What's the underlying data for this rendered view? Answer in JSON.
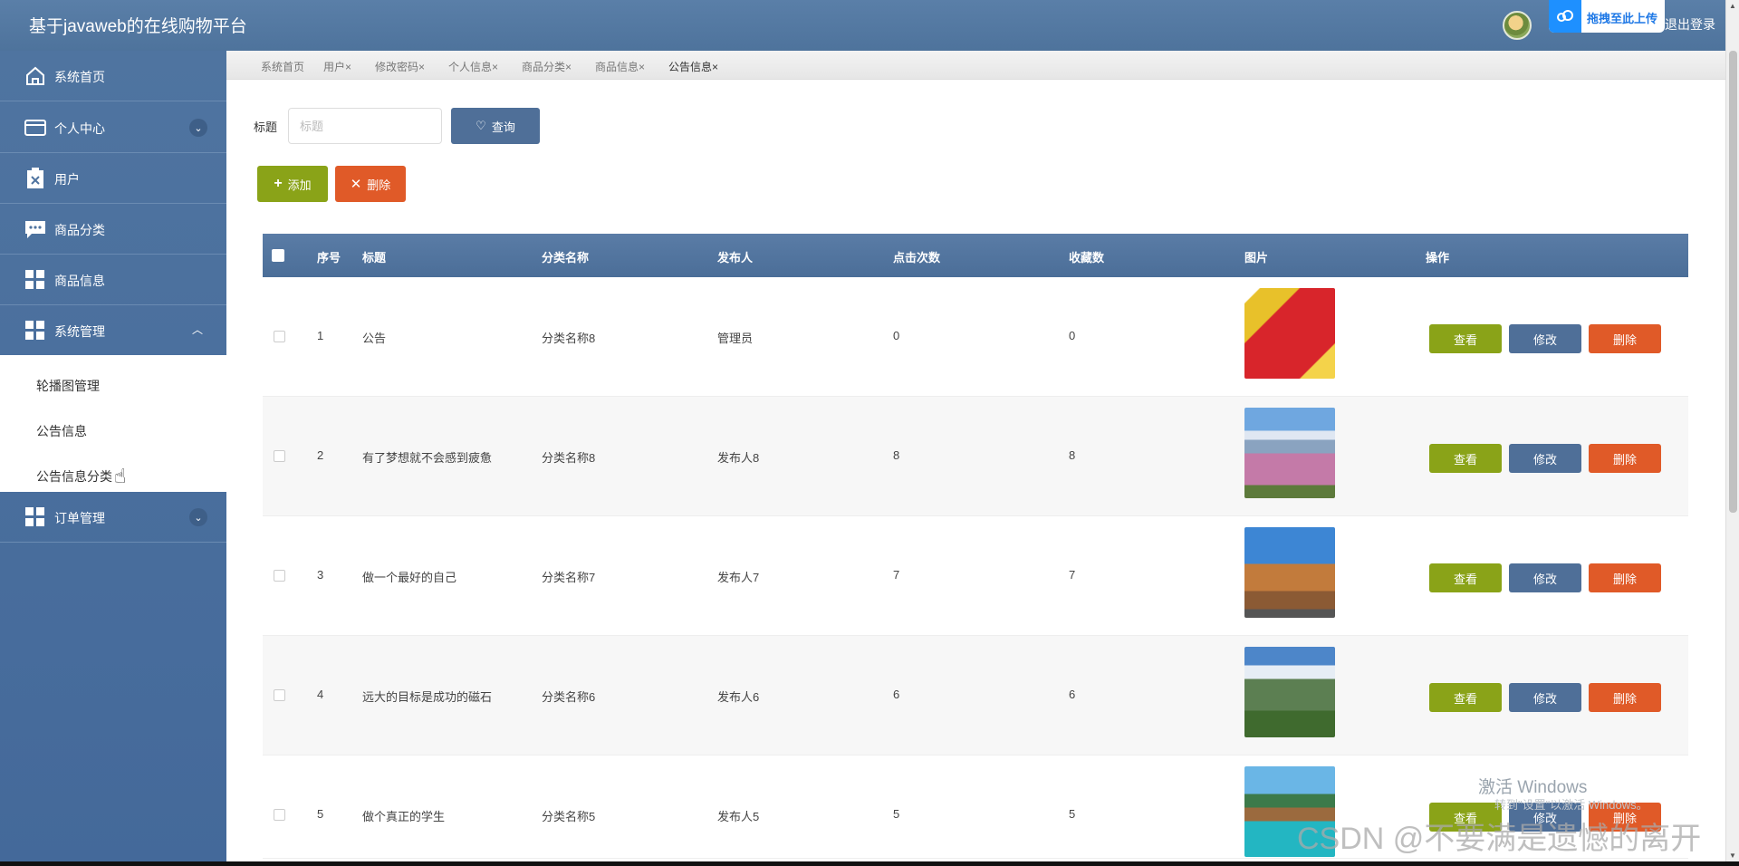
{
  "header": {
    "app_title": "基于javaweb的在线购物平台",
    "upload_label": "拖拽至此上传",
    "logout_label": "退出登录"
  },
  "sidebar": {
    "items": [
      {
        "label": "系统首页",
        "icon": "home-icon"
      },
      {
        "label": "个人中心",
        "icon": "card-icon",
        "expandable": true
      },
      {
        "label": "用户",
        "icon": "clipboard-icon"
      },
      {
        "label": "商品分类",
        "icon": "chat-icon"
      },
      {
        "label": "商品信息",
        "icon": "grid-icon"
      },
      {
        "label": "系统管理",
        "icon": "grid-icon",
        "expanded": true
      },
      {
        "label": "订单管理",
        "icon": "grid-icon",
        "expandable": true
      }
    ],
    "submenu": [
      "轮播图管理",
      "公告信息",
      "公告信息分类"
    ]
  },
  "tabs": [
    "系统首页",
    "用户",
    "修改密码",
    "个人信息",
    "商品分类",
    "商品信息",
    "公告信息"
  ],
  "tab_close": "×",
  "search": {
    "label": "标题",
    "placeholder": "标题",
    "query_button": "查询"
  },
  "actions": {
    "add": "添加",
    "delete": "删除"
  },
  "table": {
    "headers": [
      "序号",
      "标题",
      "分类名称",
      "发布人",
      "点击次数",
      "收藏数",
      "图片",
      "操作"
    ],
    "rows": [
      {
        "no": "1",
        "title": "公告",
        "category": "分类名称8",
        "publisher": "管理员",
        "clicks": "0",
        "favorites": "0",
        "image": "drink-pack"
      },
      {
        "no": "2",
        "title": "有了梦想就不会感到疲惫",
        "category": "分类名称8",
        "publisher": "发布人8",
        "clicks": "8",
        "favorites": "8",
        "image": "mount-fuji-blossoms"
      },
      {
        "no": "3",
        "title": "做一个最好的自己",
        "category": "分类名称7",
        "publisher": "发布人7",
        "clicks": "7",
        "favorites": "7",
        "image": "prague-tower"
      },
      {
        "no": "4",
        "title": "远大的目标是成功的磁石",
        "category": "分类名称6",
        "publisher": "发布人6",
        "clicks": "6",
        "favorites": "6",
        "image": "mountain-meadow"
      },
      {
        "no": "5",
        "title": "做个真正的学生",
        "category": "分类名称5",
        "publisher": "发布人5",
        "clicks": "5",
        "favorites": "5",
        "image": "tropical-resort"
      }
    ],
    "row_actions": {
      "view": "查看",
      "edit": "修改",
      "delete": "删除"
    }
  },
  "overlay": {
    "activate_windows": "激活 Windows",
    "activate_hint": "转到\"设置\"以激活 Windows。",
    "csdn_watermark": "CSDN @不要满是遗憾的离开"
  },
  "colors": {
    "header": "#5a7fa8",
    "sidebar": "#4f74a0",
    "view_button": "#8aa318",
    "edit_button": "#4f6f98",
    "delete_button": "#e05a28"
  }
}
